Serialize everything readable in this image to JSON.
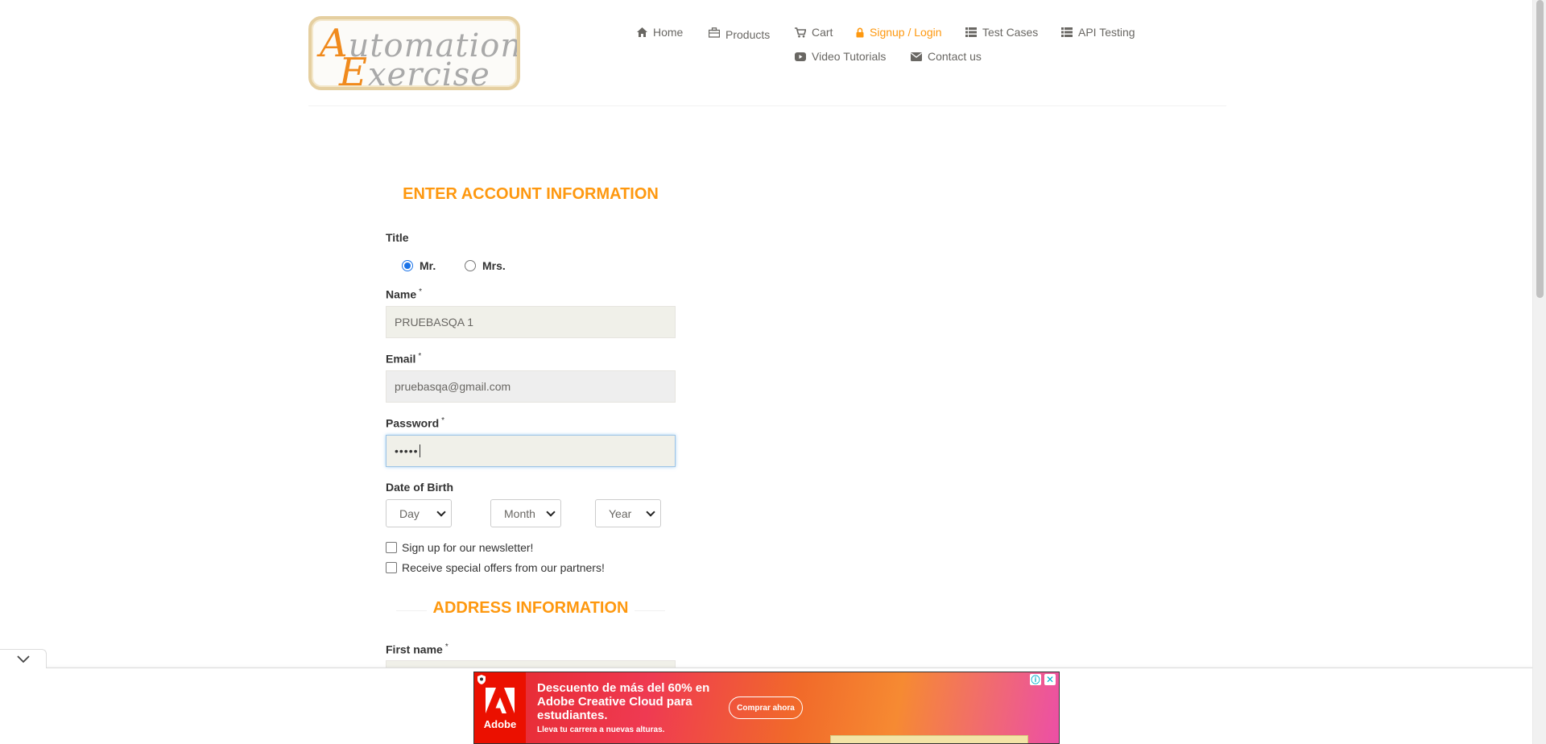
{
  "brand": {
    "logo_line1_cap": "A",
    "logo_line1_rest": "utomation",
    "logo_line2_cap": "E",
    "logo_line2_rest": "xercise"
  },
  "nav": {
    "home": "Home",
    "products": "Products",
    "cart": "Cart",
    "signup_login": "Signup / Login",
    "test_cases": "Test Cases",
    "api_testing": "API Testing",
    "video_tutorials": "Video Tutorials",
    "contact_us": "Contact us",
    "active_color": "#fe980f"
  },
  "form": {
    "heading": "ENTER ACCOUNT INFORMATION",
    "title_label": "Title",
    "title_options": [
      "Mr.",
      "Mrs."
    ],
    "title_selected": "Mr.",
    "name_label": "Name",
    "name_value": "PRUEBASQA 1",
    "email_label": "Email",
    "email_value": "pruebasqa@gmail.com",
    "password_label": "Password",
    "password_value": "•••••",
    "required_mark": "*",
    "dob_label": "Date of Birth",
    "day_value": "Day",
    "month_value": "Month",
    "year_value": "Year",
    "newsletter_label": "Sign up for our newsletter!",
    "offers_label": "Receive special offers from our partners!",
    "address_heading": "ADDRESS INFORMATION",
    "first_name_label": "First name"
  },
  "ad": {
    "brand": "Adobe",
    "headline": "Descuento de más del 60% en Adobe Creative Cloud para estudiantes.",
    "subline": "Lleva tu carrera a nuevas alturas.",
    "cta": "Comprar ahora",
    "info_glyph": "ⓘ",
    "close_glyph": "✕"
  }
}
